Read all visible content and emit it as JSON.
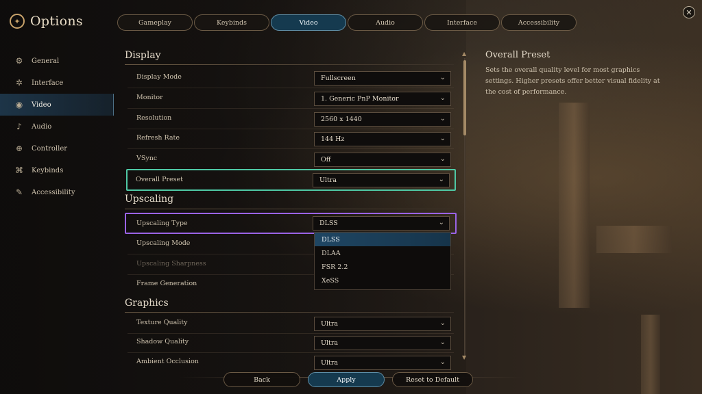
{
  "app": {
    "title": "Options",
    "logo_icon": "tri-dot-logo-icon",
    "close_icon": "close-icon"
  },
  "tabs": [
    {
      "label": "Gameplay",
      "active": false
    },
    {
      "label": "Keybinds",
      "active": false
    },
    {
      "label": "Video",
      "active": true
    },
    {
      "label": "Audio",
      "active": false
    },
    {
      "label": "Interface",
      "active": false
    },
    {
      "label": "Accessibility",
      "active": false
    }
  ],
  "sidebar": {
    "items": [
      {
        "label": "General",
        "icon": "gears-icon"
      },
      {
        "label": "Interface",
        "icon": "interface-icon"
      },
      {
        "label": "Video",
        "icon": "video-icon",
        "active": true
      },
      {
        "label": "Audio",
        "icon": "speaker-icon"
      },
      {
        "label": "Controller",
        "icon": "controller-icon"
      },
      {
        "label": "Keybinds",
        "icon": "keybinds-icon"
      },
      {
        "label": "Accessibility",
        "icon": "accessibility-icon"
      }
    ]
  },
  "sections": {
    "display": {
      "title": "Display",
      "rows": [
        {
          "label": "Display Mode",
          "value": "Fullscreen"
        },
        {
          "label": "Monitor",
          "value": "1. Generic PnP Monitor"
        },
        {
          "label": "Resolution",
          "value": "2560 x 1440"
        },
        {
          "label": "Refresh Rate",
          "value": "144 Hz"
        },
        {
          "label": "VSync",
          "value": "Off"
        },
        {
          "label": "Overall Preset",
          "value": "Ultra"
        }
      ]
    },
    "upscaling": {
      "title": "Upscaling",
      "rows": [
        {
          "label": "Upscaling Type",
          "value": "DLSS"
        },
        {
          "label": "Upscaling Mode"
        },
        {
          "label": "Upscaling Sharpness",
          "disabled": true
        },
        {
          "label": "Frame Generation"
        }
      ],
      "dropdown_options": [
        "DLSS",
        "DLAA",
        "FSR 2.2",
        "XeSS"
      ],
      "dropdown_selected": "DLSS"
    },
    "graphics": {
      "title": "Graphics",
      "rows": [
        {
          "label": "Texture Quality",
          "value": "Ultra"
        },
        {
          "label": "Shadow Quality",
          "value": "Ultra"
        },
        {
          "label": "Ambient Occlusion",
          "value": "Ultra"
        }
      ]
    }
  },
  "description": {
    "title": "Overall Preset",
    "text": "Sets the overall quality level for most graphics settings. Higher presets offer better visual fidelity at the cost of performance."
  },
  "footer": {
    "back": "Back",
    "apply": "Apply",
    "reset": "Reset to Default"
  },
  "colors": {
    "accent_blue": "#153a4f",
    "highlight_green": "#4fc9a5",
    "highlight_purple": "#9a63e6",
    "gold": "#c9a36b"
  }
}
